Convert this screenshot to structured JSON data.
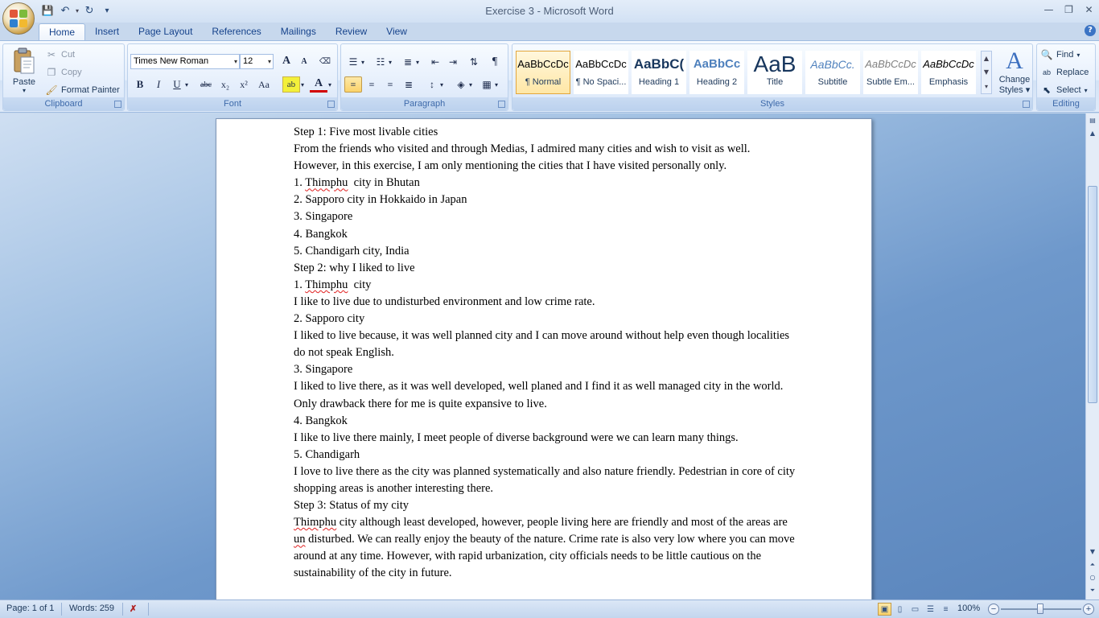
{
  "window": {
    "title": "Exercise 3 - Microsoft Word"
  },
  "qat": {
    "save": "💾",
    "undo": "↶",
    "redo": "↻",
    "customize": "▾"
  },
  "window_controls": {
    "minimize": "—",
    "maximize": "❐",
    "close": "✕"
  },
  "tabs": [
    "Home",
    "Insert",
    "Page Layout",
    "References",
    "Mailings",
    "Review",
    "View"
  ],
  "help": "?",
  "clipboard": {
    "label": "Clipboard",
    "paste": "Paste",
    "cut": "Cut",
    "copy": "Copy",
    "format_painter": "Format Painter"
  },
  "font": {
    "label": "Font",
    "name": "Times New Roman",
    "size": "12",
    "grow": "A",
    "shrink": "A",
    "bold": "B",
    "italic": "I",
    "underline": "U",
    "strike": "abc",
    "subscript": "x₂",
    "superscript": "x²",
    "case": "Aa",
    "highlight": "ab",
    "font_color": "A"
  },
  "paragraph": {
    "label": "Paragraph"
  },
  "styles": {
    "label": "Styles",
    "items": [
      {
        "sample": "AaBbCcDc",
        "name": "¶ Normal"
      },
      {
        "sample": "AaBbCcDc",
        "name": "¶ No Spaci..."
      },
      {
        "sample": "AaBbC(",
        "name": "Heading 1"
      },
      {
        "sample": "AaBbCc",
        "name": "Heading 2"
      },
      {
        "sample": "AaB",
        "name": "Title"
      },
      {
        "sample": "AaBbCc.",
        "name": "Subtitle"
      },
      {
        "sample": "AaBbCcDc",
        "name": "Subtle Em..."
      },
      {
        "sample": "AaBbCcDc",
        "name": "Emphasis"
      }
    ],
    "change_styles_1": "Change",
    "change_styles_2": "Styles"
  },
  "editing": {
    "label": "Editing",
    "find": "Find",
    "replace": "Replace",
    "select": "Select"
  },
  "document": {
    "p1": "Step 1: Five most livable cities",
    "p2": "From the friends who visited and through Medias, I admired many cities and wish to visit as well. However, in this exercise, I am only mentioning the cities that I have visited personally only.",
    "p3a": "1. ",
    "p3b": "Thimphu",
    "p3c": "  city in Bhutan",
    "p4": "2. Sapporo city in Hokkaido in Japan",
    "p5": "3. Singapore",
    "p6": "4. Bangkok",
    "p7": "5. Chandigarh city, India",
    "p8": "Step 2: why I liked to live",
    "p9a": "1. ",
    "p9b": "Thimphu",
    "p9c": "  city",
    "p10": "I like to live due to undisturbed environment and low crime rate.",
    "p11": "2. Sapporo city",
    "p12": "I liked to live because, it was well planned city and I can move around without help even though localities do not speak English.",
    "p13": "3. Singapore",
    "p14": "I liked to live there, as it was well developed, well planed and I find it as well managed city in the world. Only drawback there for me is quite expansive to live.",
    "p15": "4. Bangkok",
    "p16": "I like to live there mainly, I meet people of diverse background were we can learn many things.",
    "p17": "5. Chandigarh",
    "p18": "I love to live there as the city was planned systematically and also nature friendly. Pedestrian in core of city shopping areas is another interesting there.",
    "p19": "Step 3: Status of my city",
    "p20a": "Thimphu",
    "p20b": " city although least developed, however, people living here are friendly and most of the areas are ",
    "p20c": "un",
    "p20d": " disturbed. We can really  enjoy the beauty of the nature. Crime rate is also very low where you can move around at any time. However, with rapid urbanization, city officials needs to be little cautious on the sustainability of the city in  future."
  },
  "status": {
    "page": "Page: 1 of 1",
    "words": "Words: 259",
    "zoom": "100%"
  }
}
